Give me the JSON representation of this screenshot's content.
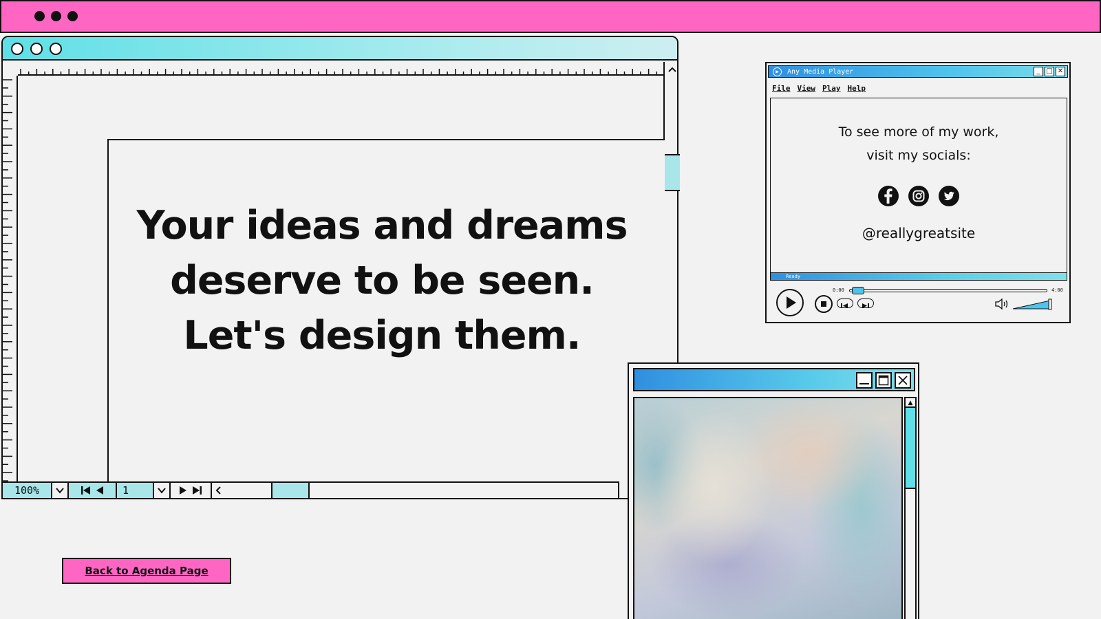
{
  "headline": {
    "line1": "Your ideas and dreams",
    "line2": "deserve to be seen.",
    "line3": "Let's design them."
  },
  "editor_toolbar": {
    "zoom": "100%",
    "page_number": "1"
  },
  "back_button": {
    "label": "Back to Agenda Page"
  },
  "media_player": {
    "title": "Any Media Player",
    "menu": [
      "File",
      "View",
      "Play",
      "Help"
    ],
    "message_line1": "To see more of my work,",
    "message_line2": "visit my socials:",
    "social_icons": [
      "facebook-icon",
      "instagram-icon",
      "twitter-icon"
    ],
    "handle": "@reallygreatsite",
    "status": "Ready",
    "time_start": "0:00",
    "time_end": "4:00",
    "progress_fraction": 0.02,
    "volume_fraction": 1.0
  },
  "colors": {
    "pink": "#ff66c4",
    "cyan": "#5ee0e6",
    "light_cyan": "#a8e6ea",
    "blue": "#2f8fe0",
    "background": "#f2f2f2"
  }
}
